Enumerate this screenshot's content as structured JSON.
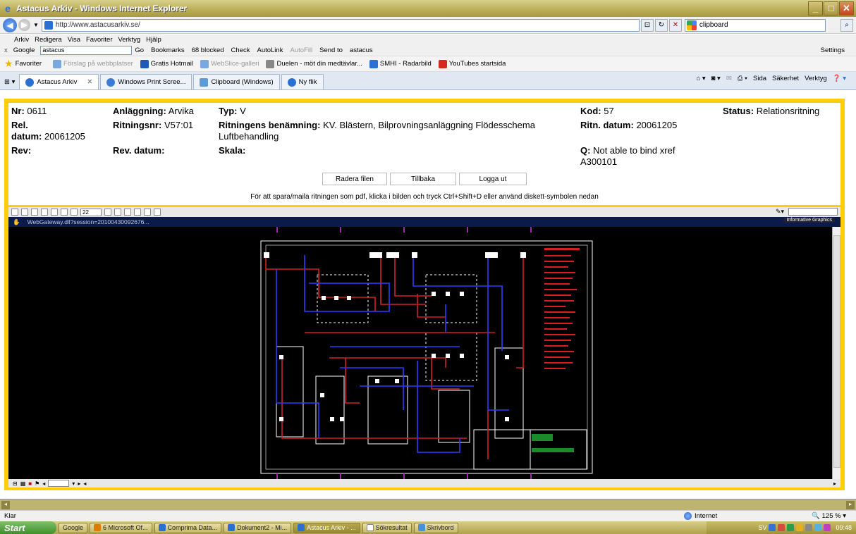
{
  "window": {
    "title": "Astacus Arkiv - Windows Internet Explorer"
  },
  "addressbar": {
    "url": "http://www.astacusarkiv.se/",
    "search_value": "clipboard"
  },
  "menu": [
    "Arkiv",
    "Redigera",
    "Visa",
    "Favoriter",
    "Verktyg",
    "Hjälp"
  ],
  "googlebar": {
    "label": "Google",
    "search_value": "astacus",
    "items": [
      "Go",
      "Bookmarks",
      "68 blocked",
      "Check",
      "AutoLink",
      "AutoFill",
      "Send to",
      "astacus"
    ],
    "settings": "Settings"
  },
  "favorites": {
    "label": "Favoriter",
    "items": [
      "Förslag på webbplatser",
      "Gratis Hotmail",
      "WebSlice-galleri",
      "Duelen - möt din medtävlar...",
      "SMHI - Radarbild",
      "YouTubes startsida"
    ]
  },
  "tabs": [
    {
      "label": "Astacus Arkiv",
      "active": true
    },
    {
      "label": "Windows Print Scree...",
      "active": false
    },
    {
      "label": "Clipboard (Windows)",
      "active": false
    },
    {
      "label": "Ny flik",
      "active": false
    }
  ],
  "commandbar": [
    "Sida",
    "Säkerhet",
    "Verktyg"
  ],
  "info": {
    "nr_label": "Nr:",
    "nr": "0611",
    "anl_label": "Anläggning:",
    "anl": "Arvika",
    "typ_label": "Typ:",
    "typ": "V",
    "kod_label": "Kod:",
    "kod": "57",
    "status_label": "Status:",
    "status": "Relationsritning",
    "reldatum_label1": "Rel.",
    "reldatum_label2": "datum:",
    "reldatum": "20061205",
    "ritnr_label": "Ritningsnr:",
    "ritnr": "V57:01",
    "benamning_label": "Ritningens benämning:",
    "benamning1": "KV. Blästern, Bilprovningsanläggning Flödesschema",
    "benamning2": "Luftbehandling",
    "ritndatum_label": "Ritn. datum:",
    "ritndatum": "20061205",
    "rev_label": "Rev:",
    "revdatum_label": "Rev. datum:",
    "skala_label": "Skala:",
    "q_label": "Q:",
    "q1": "Not able to bind xref",
    "q2": "A300101"
  },
  "buttons": {
    "delete": "Radera filen",
    "back": "Tillbaka",
    "logout": "Logga ut"
  },
  "hint": "För att spara/maila ritningen som pdf, klicka i bilden och tryck Ctrl+Shift+D eller använd diskett-symbolen nedan",
  "viewer": {
    "zoom": "22",
    "session": "WebGateway.dll?session=20100430092676...",
    "brand": "Informative Graphics"
  },
  "status": {
    "left": "Klar",
    "zone": "Internet",
    "zoom": "125 %"
  },
  "taskbar": {
    "start": "Start",
    "tasks": [
      "Google",
      "6 Microsoft Of...",
      "Comprima Data...",
      "Dokument2 - Mi...",
      "Astacus Arkiv - ...",
      "Sökresultat",
      "Skrivbord"
    ],
    "time": "09:48",
    "lang": "SV"
  }
}
